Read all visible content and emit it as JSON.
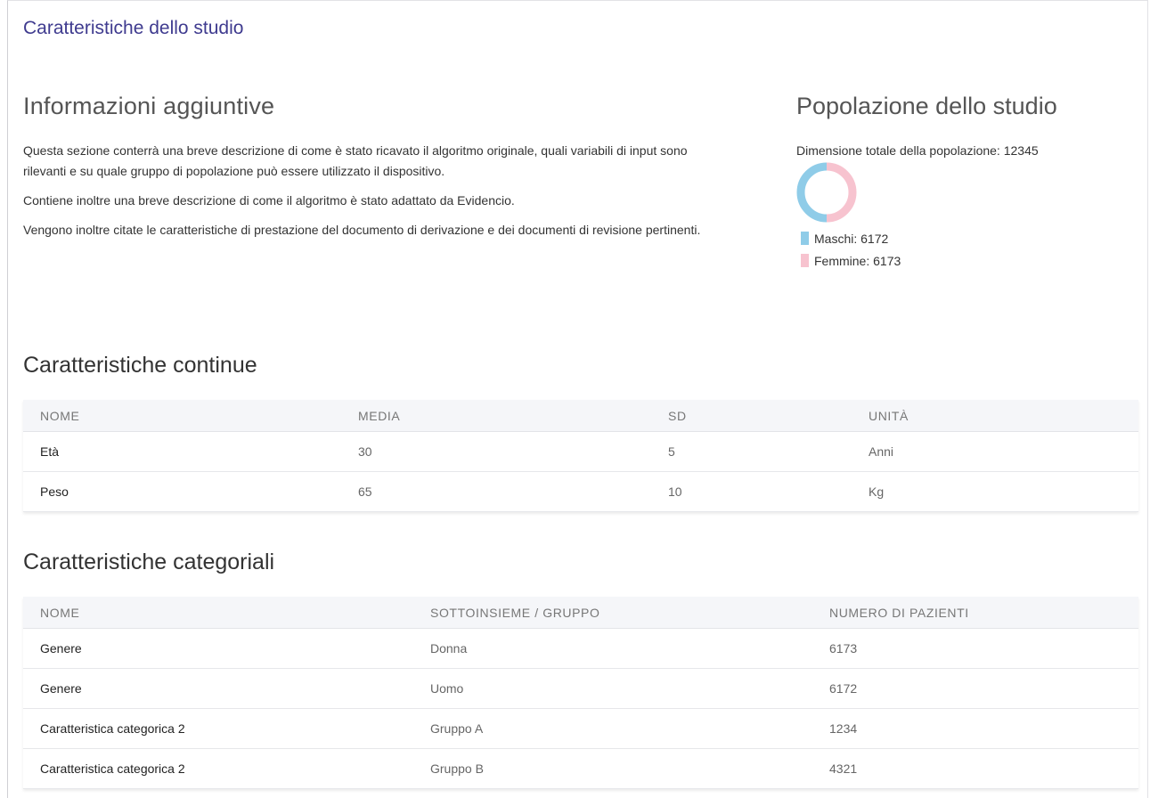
{
  "page": {
    "title": "Caratteristiche dello studio"
  },
  "info": {
    "heading": "Informazioni aggiuntive",
    "paragraphs": [
      "Questa sezione conterrà una breve descrizione di come è stato ricavato il algoritmo originale, quali variabili di input sono rilevanti e su quale gruppo di popolazione può essere utilizzato il dispositivo.",
      "Contiene inoltre una breve descrizione di come il algoritmo è stato adattato da Evidencio.",
      "Vengono inoltre citate le caratteristiche di prestazione del documento di derivazione e dei documenti di revisione pertinenti."
    ]
  },
  "population": {
    "heading": "Popolazione dello studio",
    "total": "Dimensione totale della popolazione: 12345",
    "legend": [
      {
        "label": "Maschi: 6172",
        "value": 6172,
        "color": "#8fcce8"
      },
      {
        "label": "Femmine: 6173",
        "value": 6173,
        "color": "#f7c3cf"
      }
    ]
  },
  "continuous": {
    "heading": "Caratteristiche continue",
    "columns": [
      "NOME",
      "MEDIA",
      "SD",
      "UNITÀ"
    ],
    "rows": [
      [
        "Età",
        "30",
        "5",
        "Anni"
      ],
      [
        "Peso",
        "65",
        "10",
        "Kg"
      ]
    ]
  },
  "categorical": {
    "heading": "Caratteristiche categoriali",
    "columns": [
      "NOME",
      "SOTTOINSIEME / GRUPPO",
      "NUMERO DI PAZIENTI"
    ],
    "rows": [
      [
        "Genere",
        "Donna",
        "6173"
      ],
      [
        "Genere",
        "Uomo",
        "6172"
      ],
      [
        "Caratteristica categorica 2",
        "Gruppo A",
        "1234"
      ],
      [
        "Caratteristica categorica 2",
        "Gruppo B",
        "4321"
      ]
    ]
  }
}
